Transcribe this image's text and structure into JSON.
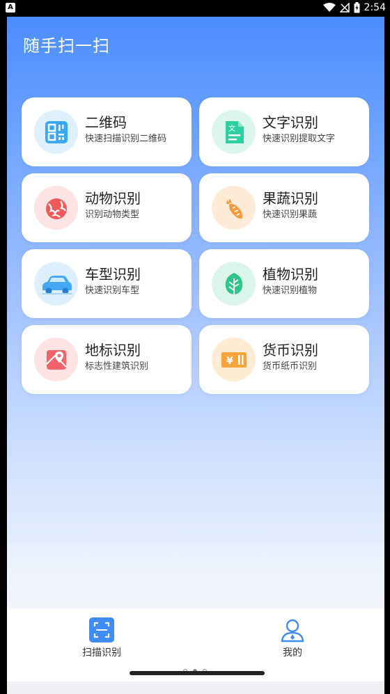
{
  "status_bar": {
    "left_badge": "A",
    "time": "2:54",
    "icons": [
      "wifi-icon",
      "signal-icon",
      "battery-icon"
    ]
  },
  "app": {
    "title": "随手扫一扫"
  },
  "cards": [
    {
      "title": "二维码",
      "subtitle": "快速扫描识别二维码",
      "icon": "qr-code-icon",
      "color": "#3aa7f0"
    },
    {
      "title": "文字识别",
      "subtitle": "快速识别提取文字",
      "icon": "document-text-icon",
      "color": "#2ecfa3"
    },
    {
      "title": "动物识别",
      "subtitle": "识别动物类型",
      "icon": "animal-icon",
      "color": "#f05a5a"
    },
    {
      "title": "果蔬识别",
      "subtitle": "快速识别果蔬",
      "icon": "carrot-icon",
      "color": "#f59a3c"
    },
    {
      "title": "车型识别",
      "subtitle": "快速识别车型",
      "icon": "car-icon",
      "color": "#44a9f2"
    },
    {
      "title": "植物识别",
      "subtitle": "快速识别植物",
      "icon": "leaf-icon",
      "color": "#2fc58d"
    },
    {
      "title": "地标识别",
      "subtitle": "标志性建筑识别",
      "icon": "map-pin-icon",
      "color": "#f2626a"
    },
    {
      "title": "货币识别",
      "subtitle": "货币纸币识别",
      "icon": "currency-icon",
      "color": "#f5a43c"
    }
  ],
  "tabbar": {
    "scan_label": "扫描识别",
    "mine_label": "我的",
    "accent": "#3f8cf5"
  }
}
